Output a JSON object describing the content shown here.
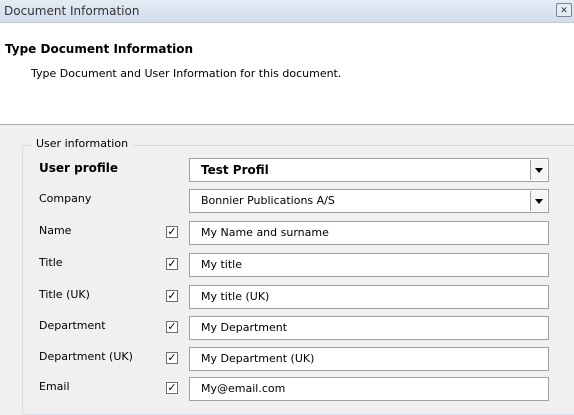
{
  "window": {
    "title": "Document Information",
    "close_glyph": "✕"
  },
  "header": {
    "title": "Type Document Information",
    "subtitle": "Type Document and User Information for this document."
  },
  "group": {
    "legend": "User information"
  },
  "user_profile": {
    "label": "User profile",
    "value": "Test Profil"
  },
  "company": {
    "label": "Company",
    "value": "Bonnier Publications A/S"
  },
  "fields": [
    {
      "label": "Name",
      "checked": true,
      "value": "My Name and surname"
    },
    {
      "label": "Title",
      "checked": true,
      "value": "My title"
    },
    {
      "label": "Title (UK)",
      "checked": true,
      "value": "My title (UK)"
    },
    {
      "label": "Department",
      "checked": true,
      "value": "My Department"
    },
    {
      "label": "Department (UK)",
      "checked": true,
      "value": "My Department (UK)"
    },
    {
      "label": "Email",
      "checked": true,
      "value": "My@email.com"
    }
  ],
  "check_glyph": "✓"
}
